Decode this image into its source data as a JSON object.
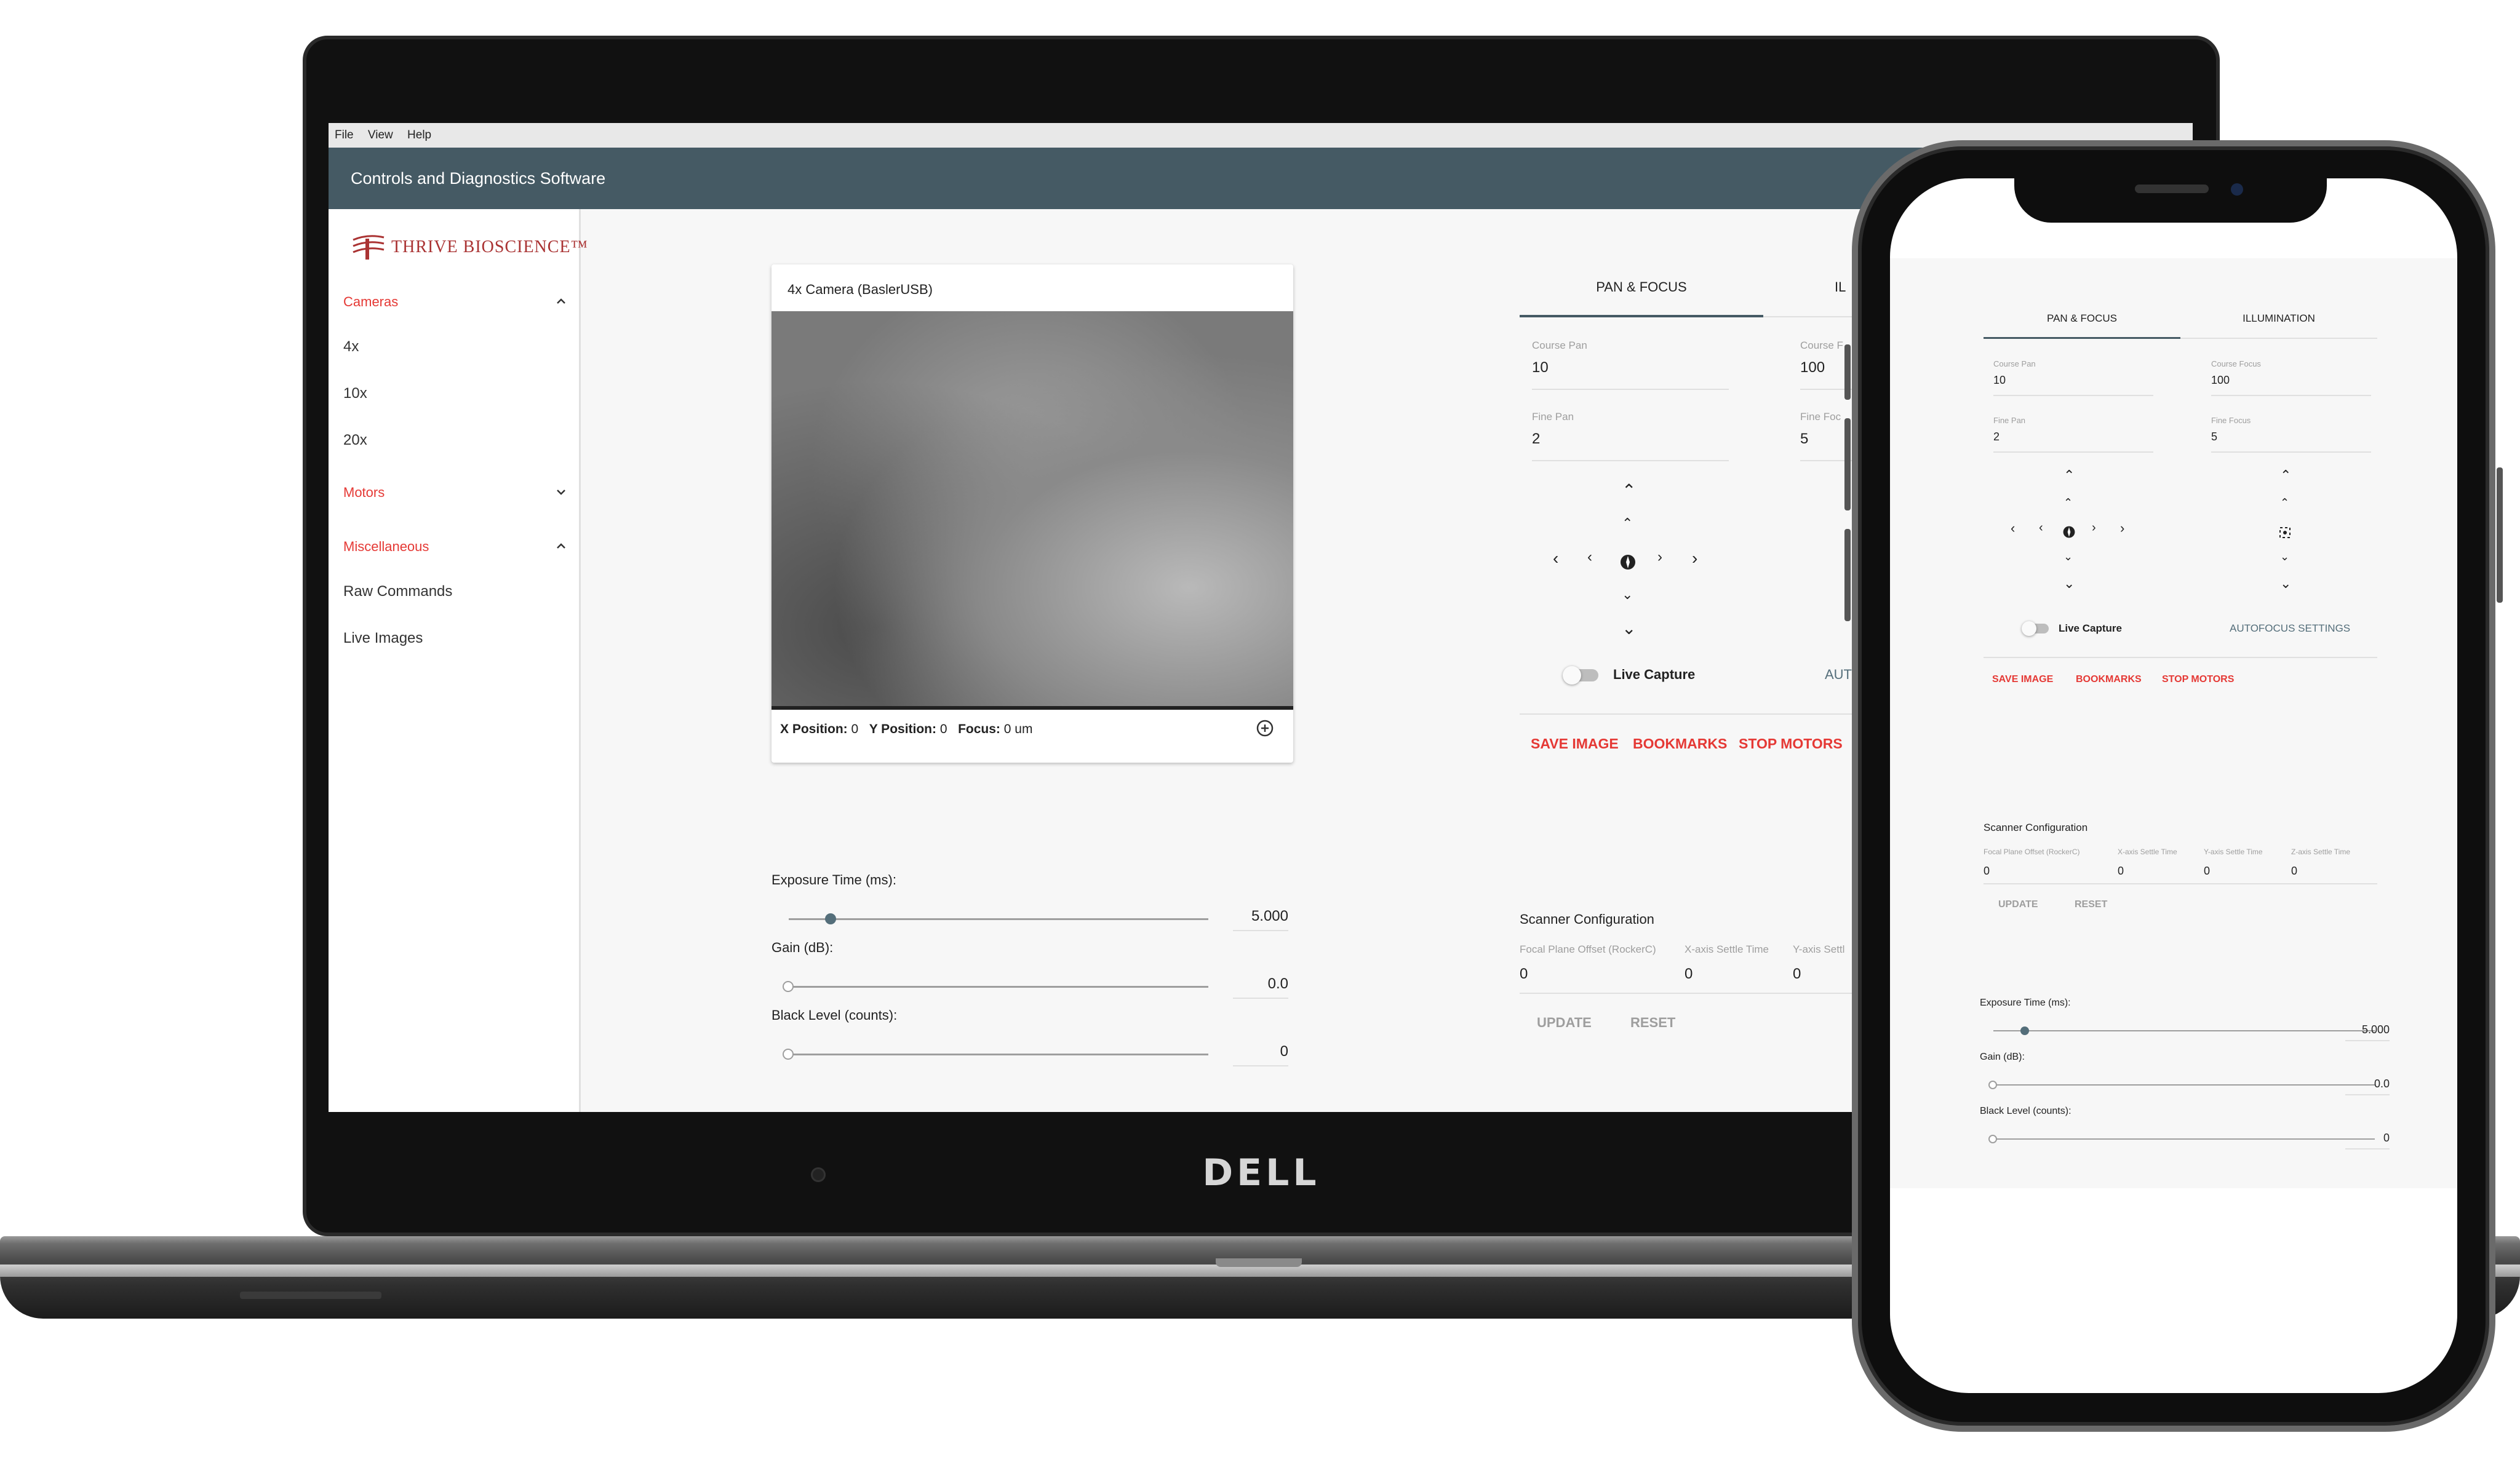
{
  "menu": {
    "file": "File",
    "view": "View",
    "help": "Help"
  },
  "app_title": "Controls and Diagnostics Software",
  "brand": {
    "logo_text": "THRIVE BIOSCIENCE™",
    "device_logo": "DELL"
  },
  "sidebar": {
    "cameras": {
      "label": "Cameras",
      "items": [
        "4x",
        "10x",
        "20x"
      ]
    },
    "motors": {
      "label": "Motors"
    },
    "misc": {
      "label": "Miscellaneous",
      "items": [
        "Raw Commands",
        "Live Images"
      ]
    }
  },
  "camera": {
    "title": "4x Camera (BaslerUSB)",
    "x_label": "X Position:",
    "x_value": "0",
    "y_label": "Y Position:",
    "y_value": "0",
    "focus_label": "Focus:",
    "focus_value": "0 um"
  },
  "sliders": {
    "exposure": {
      "label": "Exposure Time (ms):",
      "value": "5.000",
      "level": 0.1
    },
    "gain": {
      "label": "Gain (dB):",
      "value": "0.0",
      "level": 0
    },
    "black": {
      "label": "Black Level (counts):",
      "value": "0",
      "level": 0
    }
  },
  "tabs": {
    "pan_focus": "PAN & FOCUS",
    "illumination": "ILLUMINATION",
    "illumination_partial": "IL"
  },
  "fields": {
    "course_pan": {
      "label": "Course Pan",
      "value": "10"
    },
    "course_focus": {
      "label": "Course Focus",
      "value": "100"
    },
    "course_focus_partial": "Course F",
    "fine_pan": {
      "label": "Fine Pan",
      "value": "2"
    },
    "fine_focus": {
      "label": "Fine Focus",
      "value": "5"
    },
    "fine_focus_partial": "Fine Foc"
  },
  "live_capture": "Live Capture",
  "autofocus": "AUTOFOCUS SETTINGS",
  "autofocus_partial": "AUT",
  "actions": {
    "save": "SAVE IMAGE",
    "bookmarks": "BOOKMARKS",
    "stop": "STOP MOTORS"
  },
  "scanner": {
    "title": "Scanner Configuration",
    "cols": [
      "Focal Plane Offset (RockerC)",
      "X-axis Settle Time",
      "Y-axis Settle Time",
      "Z-axis Settle Time"
    ],
    "col_y_partial": "Y-axis Settl",
    "values": [
      "0",
      "0",
      "0",
      "0"
    ],
    "update": "UPDATE",
    "reset": "RESET"
  }
}
